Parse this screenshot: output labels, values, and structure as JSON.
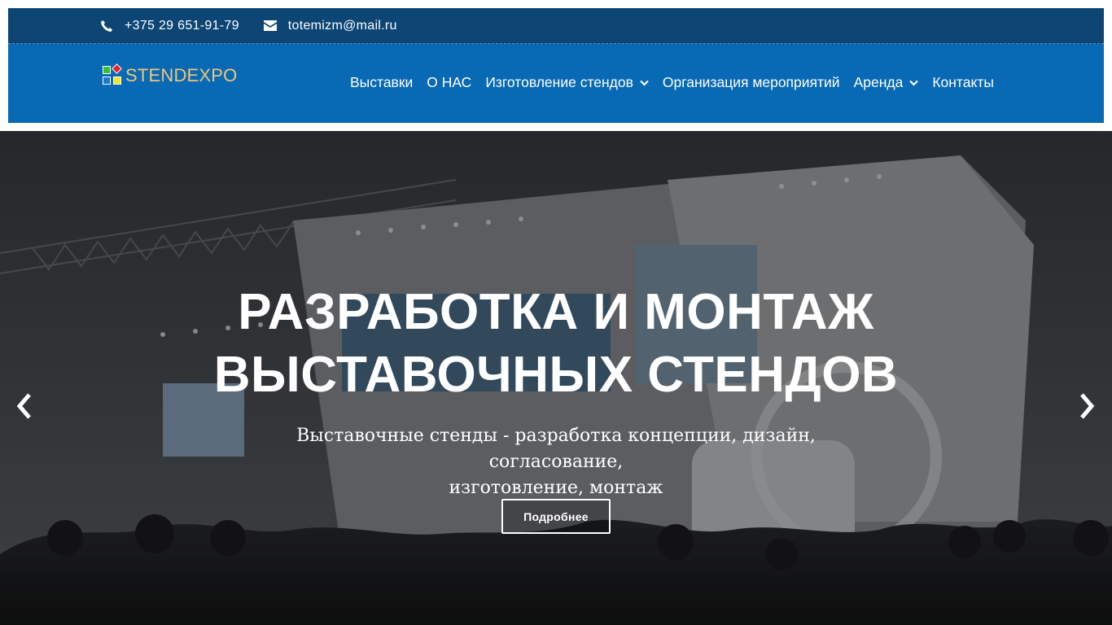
{
  "topbar": {
    "phone": "+375 29 651-91-79",
    "email": "totemizm@mail.ru",
    "phone_icon": "phone-icon",
    "email_icon": "envelope-icon"
  },
  "logo": {
    "text": "STENDEXPO"
  },
  "nav": {
    "items": [
      {
        "label": "Выставки",
        "has_dropdown": false
      },
      {
        "label": "О НАС",
        "has_dropdown": false
      },
      {
        "label": "Изготовление стендов",
        "has_dropdown": true
      },
      {
        "label": "Организация мероприятий",
        "has_dropdown": false
      },
      {
        "label": "Аренда",
        "has_dropdown": true
      },
      {
        "label": "Контакты",
        "has_dropdown": false
      }
    ]
  },
  "hero": {
    "title_line1": "РАЗРАБОТКА И МОНТАЖ",
    "title_line2": "ВЫСТАВОЧНЫХ СТЕНДОВ",
    "subtitle_line1": "Выставочные стенды - разработка концепции, дизайн, согласование,",
    "subtitle_line2": "изготовление, монтаж",
    "button_label": "Подробнее",
    "prev_icon": "chevron-left-icon",
    "next_icon": "chevron-right-icon"
  },
  "colors": {
    "topbar_bg": "#0d4574",
    "navbar_bg": "#0869b5",
    "logo_text": "#f1c678",
    "text": "#ffffff"
  }
}
